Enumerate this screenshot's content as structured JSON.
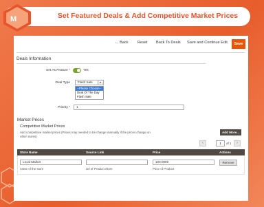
{
  "header": {
    "title": "Set Featured Deals & Add Competitive Market Prices"
  },
  "toolbar": {
    "back": "← Back",
    "reset": "Reset",
    "back_to_deals": "Back To Deals",
    "save_continue": "Save and Continue Edit",
    "save": "Save"
  },
  "deals_info": {
    "title": "Deals Information",
    "set_as_feature_label": "Set As Feature",
    "set_as_feature_value": "Yes",
    "deal_type_label": "Deal Type",
    "deal_type_value": "Flash Sale",
    "deal_type_options": [
      "--Please Choose--",
      "Deal Of The Day",
      "Flash Sale"
    ],
    "priority_label": "Priority",
    "priority_value": "1"
  },
  "market_prices": {
    "title": "Market Prices",
    "subtitle": "Competitive Market Prices",
    "description_line1": "Add competitive market prices (Prices may needed to be change manually if the prices change on",
    "description_line2": "other stores)",
    "add_more": "Add More...",
    "pager_current": "1",
    "pager_of": "of 1",
    "columns": [
      "Store Name",
      "Source Link",
      "Price",
      "Actions"
    ],
    "row": {
      "store_name": "Local Market",
      "store_name_hint": "name of the store",
      "source_link": "",
      "source_link_hint": "Url of Product Store",
      "price": "100.0000",
      "price_hint": "Price of Product",
      "remove": "Remove"
    }
  },
  "colors": {
    "accent": "#e8542a",
    "save_button": "#eb5202",
    "table_header": "#514943",
    "toggle_on": "#79a22e"
  }
}
